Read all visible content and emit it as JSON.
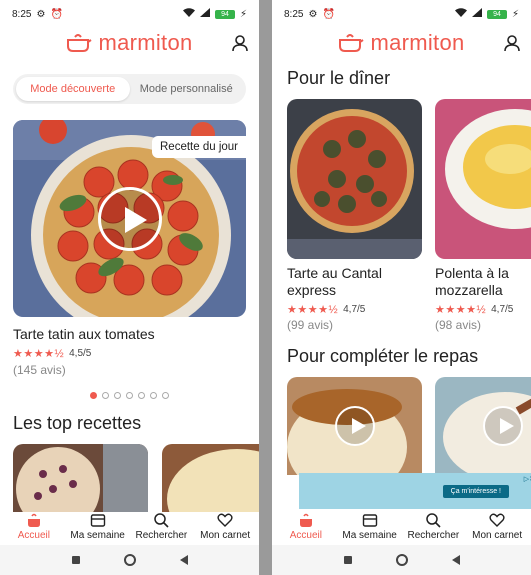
{
  "status": {
    "time": "8:25",
    "battery": "94"
  },
  "app": {
    "logo_text": "marmiton",
    "accent": "#ef5a4f"
  },
  "left": {
    "segment": {
      "discover": "Mode découverte",
      "personal": "Mode personnalisé"
    },
    "hero": {
      "badge": "Recette du jour",
      "title": "Tarte tatin aux tomates",
      "rating": "4,5/5",
      "stars": "★★★★½",
      "reviews": "(145 avis)"
    },
    "carousel": {
      "count": 7,
      "active": 1
    },
    "top_title": "Les top recettes"
  },
  "right": {
    "diner_title": "Pour le dîner",
    "diner_cards": [
      {
        "title": "Tarte au Cantal express",
        "rating": "4,7/5",
        "stars": "★★★★½",
        "reviews": "(99 avis)"
      },
      {
        "title": "Polenta à la mozzarella",
        "rating": "4,7/5",
        "stars": "★★★★½",
        "reviews": "(98 avis)"
      }
    ],
    "complete_title": "Pour compléter le repas",
    "ad": {
      "cta": "Ça m'intéresse !"
    }
  },
  "tabs": [
    {
      "label": "Accueil",
      "icon": "home-icon"
    },
    {
      "label": "Ma semaine",
      "icon": "calendar-icon"
    },
    {
      "label": "Rechercher",
      "icon": "search-icon"
    },
    {
      "label": "Mon carnet",
      "icon": "heart-icon"
    }
  ]
}
